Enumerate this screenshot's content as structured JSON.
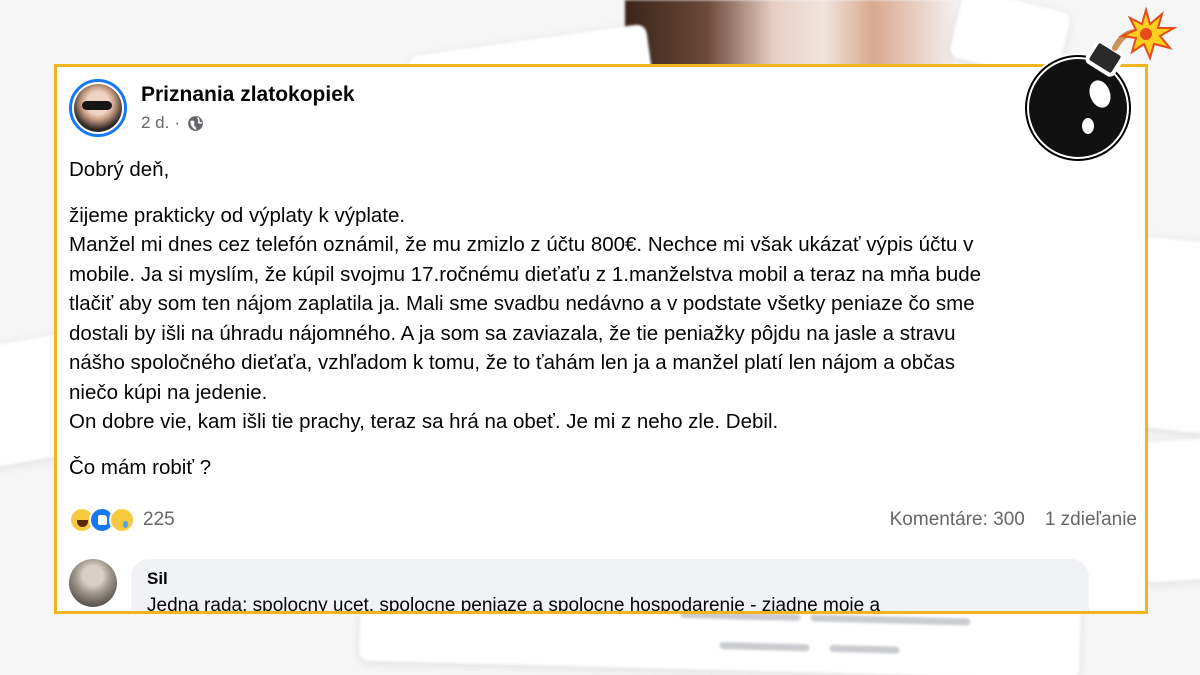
{
  "post": {
    "page_name": "Priznania zlatokopiek",
    "timestamp": "2 d.",
    "separator": "·",
    "greeting": "Dobrý deň,",
    "lines": [
      "žijeme prakticky od výplaty k výplate.",
      "Manžel mi dnes cez telefón oznámil, že mu zmizlo z účtu 800€. Nechce mi však ukázať výpis účtu v",
      "mobile. Ja si myslím, že kúpil svojmu 17.ročnému dieťaťu z 1.manželstva mobil a teraz na mňa bude",
      "tlačiť aby som ten nájom zaplatila ja. Mali sme svadbu nedávno a v podstate všetky peniaze čo sme",
      "dostali by išli na úhradu nájomného. A ja som sa zaviazala, že tie peniažky pôjdu na jasle a stravu",
      "nášho spoločného dieťaťa, vzhľadom k tomu, že to ťahám len ja a manžel platí len nájom a občas",
      "niečo kúpi na jedenie.",
      "On dobre vie, kam išli tie prachy, teraz sa hrá na obeť. Je mi z neho zle. Debil.",
      ""
    ],
    "question": "Čo mám robiť ?",
    "reaction_count": "225",
    "comments_label": "Komentáre: 300",
    "shares_label": "1 zdieľanie"
  },
  "comment": {
    "author": "Sil",
    "text": "Jedna rada: spolocny ucet, spolocne peniaze a spolocne hospodarenie - ziadne moje a"
  },
  "colors": {
    "frame_border": "#f3b51c",
    "avatar_ring": "#1877f2",
    "like_blue": "#1877f2",
    "meta_gray": "#65676b",
    "bubble_bg": "#f0f2f5"
  },
  "icons": [
    "globe-icon",
    "haha-reaction-icon",
    "like-reaction-icon",
    "sad-reaction-icon",
    "bomb-icon"
  ]
}
